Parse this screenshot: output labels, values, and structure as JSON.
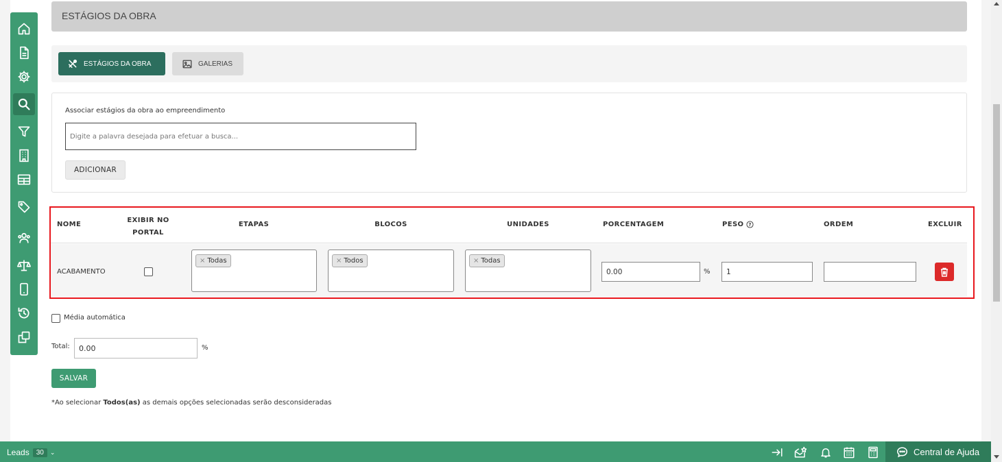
{
  "header": {
    "title": "ESTÁGIOS DA OBRA"
  },
  "tabs": [
    {
      "label": "ESTÁGIOS DA OBRA",
      "icon": "tools-icon",
      "active": true
    },
    {
      "label": "GALERIAS",
      "icon": "image-icon",
      "active": false
    }
  ],
  "sidebar": {
    "items": [
      {
        "icon": "home-icon"
      },
      {
        "icon": "document-icon"
      },
      {
        "icon": "gear-icon"
      },
      {
        "icon": "search-icon",
        "active": true
      },
      {
        "icon": "filter-icon"
      },
      {
        "icon": "building-icon"
      },
      {
        "icon": "table-icon"
      },
      {
        "icon": "tag-icon"
      },
      {
        "icon": "users-icon"
      },
      {
        "icon": "scale-icon"
      },
      {
        "icon": "mobile-icon"
      },
      {
        "icon": "history-icon"
      },
      {
        "icon": "copy-icon"
      }
    ]
  },
  "association": {
    "label": "Associar estágios da obra ao empreendimento",
    "placeholder": "Digite a palavra desejada para efetuar a busca...",
    "add_button": "ADICIONAR"
  },
  "table": {
    "headers": {
      "nome": "NOME",
      "exibir_line1": "EXIBIR NO",
      "exibir_line2": "PORTAL",
      "etapas": "ETAPAS",
      "blocos": "BLOCOS",
      "unidades": "UNIDADES",
      "porcentagem": "PORCENTAGEM",
      "peso": "PESO",
      "ordem": "ORDEM",
      "excluir": "EXCLUIR"
    },
    "rows": [
      {
        "nome": "ACABAMENTO",
        "exibir_no_portal": false,
        "etapas_tag": "Todas",
        "blocos_tag": "Todos",
        "unidades_tag": "Todas",
        "porcentagem": "0.00",
        "pct_symbol": "%",
        "peso": "1",
        "ordem": ""
      }
    ]
  },
  "media_automatica": {
    "label": "Média automática",
    "checked": false
  },
  "total": {
    "label": "Total:",
    "value": "0.00",
    "pct_symbol": "%"
  },
  "save_button": "SALVAR",
  "note": {
    "prefix": "*Ao selecionar ",
    "bold": "Todos(as)",
    "suffix": " as demais opções selecionadas serão desconsideradas"
  },
  "footer": {
    "leads_label": "Leads",
    "leads_count": "30",
    "icons": [
      "collapse-right-icon",
      "mail-open-icon",
      "bell-icon",
      "calendar-icon",
      "calculator-icon"
    ],
    "help_label": "Central de Ajuda"
  },
  "colors": {
    "brand_green": "#3e9b72",
    "brand_green_dark": "#2f7c5a",
    "tab_active": "#2c6e5e",
    "highlight_red": "#e8161c",
    "delete_red": "#dc2a2a"
  }
}
